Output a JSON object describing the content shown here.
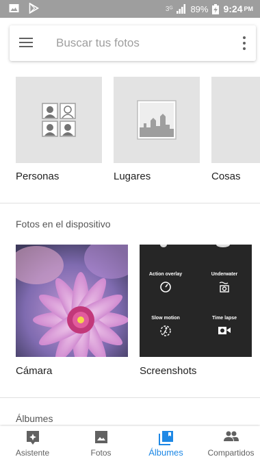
{
  "status_bar": {
    "carrier": "3ᴳ",
    "battery": "89%",
    "time": "9:24",
    "ampm": "PM"
  },
  "search": {
    "placeholder": "Buscar tus fotos"
  },
  "categories": [
    {
      "label": "Personas"
    },
    {
      "label": "Lugares"
    },
    {
      "label": "Cosas"
    }
  ],
  "device_section": {
    "title": "Fotos en el dispositivo",
    "folders": [
      {
        "label": "Cámara"
      },
      {
        "label": "Screenshots"
      }
    ],
    "screenshot_features": [
      "Action overlay",
      "Underwater",
      "Slow motion",
      "Time lapse"
    ]
  },
  "albums_section": {
    "title": "Álbumes"
  },
  "bottom_nav": {
    "items": [
      {
        "label": "Asistente",
        "icon": "assistant-icon",
        "active": false
      },
      {
        "label": "Fotos",
        "icon": "photo-icon",
        "active": false
      },
      {
        "label": "Álbumes",
        "icon": "albums-icon",
        "active": true
      },
      {
        "label": "Compartidos",
        "icon": "people-icon",
        "active": false
      }
    ]
  },
  "colors": {
    "accent": "#1e88e5",
    "status_bar": "#9e9e9e",
    "tile_background": "#e3e3e3"
  }
}
